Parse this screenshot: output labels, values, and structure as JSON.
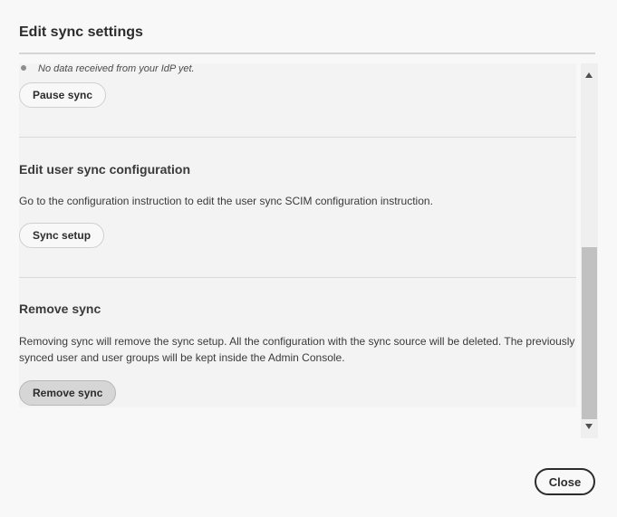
{
  "dialog": {
    "title": "Edit sync settings",
    "close_label": "Close"
  },
  "status": {
    "text": "No data received from your IdP yet."
  },
  "pause": {
    "button": "Pause sync"
  },
  "edit_config": {
    "heading": "Edit user sync configuration",
    "description": "Go to the configuration instruction to edit the user sync SCIM configuration instruction.",
    "button": "Sync setup"
  },
  "remove": {
    "heading": "Remove sync",
    "description": "Removing sync will remove the sync setup. All the configuration with the sync source will be deleted. The previously synced user and user groups will be kept inside the Admin Console.",
    "button": "Remove sync"
  }
}
